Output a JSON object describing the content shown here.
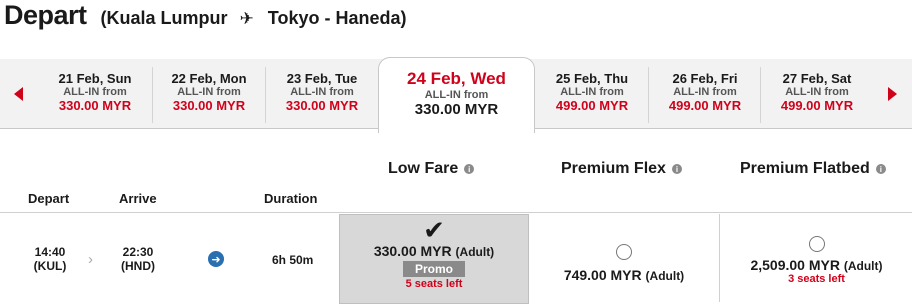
{
  "header": {
    "title": "Depart",
    "origin": "(Kuala Lumpur",
    "destination": "Tokyo - Haneda)",
    "plane_icon": "airplane-icon"
  },
  "dates": [
    {
      "label": "21 Feb, Sun",
      "sub": "ALL-IN from",
      "price": "330.00 MYR"
    },
    {
      "label": "22 Feb, Mon",
      "sub": "ALL-IN from",
      "price": "330.00 MYR"
    },
    {
      "label": "23 Feb, Tue",
      "sub": "ALL-IN from",
      "price": "330.00 MYR"
    },
    {
      "label": "24 Feb, Wed",
      "sub": "ALL-IN from",
      "price": "330.00 MYR"
    },
    {
      "label": "25 Feb, Thu",
      "sub": "ALL-IN from",
      "price": "499.00 MYR"
    },
    {
      "label": "26 Feb, Fri",
      "sub": "ALL-IN from",
      "price": "499.00 MYR"
    },
    {
      "label": "27 Feb, Sat",
      "sub": "ALL-IN from",
      "price": "499.00 MYR"
    }
  ],
  "fare_types": [
    {
      "label": "Low Fare"
    },
    {
      "label": "Premium Flex"
    },
    {
      "label": "Premium Flatbed"
    }
  ],
  "columns": {
    "depart": "Depart",
    "arrive": "Arrive",
    "duration": "Duration"
  },
  "flight": {
    "depart_time": "14:40",
    "depart_code": "(KUL)",
    "arrive_time": "22:30",
    "arrive_code": "(HND)",
    "duration": "6h 50m",
    "fares": [
      {
        "price": "330.00 MYR",
        "pax": "(Adult)",
        "badge": "Promo",
        "seats": "5 seats left",
        "selected": true
      },
      {
        "price": "749.00 MYR",
        "pax": "(Adult)",
        "seats": "",
        "selected": false
      },
      {
        "price": "2,509.00 MYR",
        "pax": "(Adult)",
        "seats": "3 seats left",
        "selected": false
      }
    ]
  },
  "colors": {
    "accent": "#d0021b",
    "selected_bg": "#d8d8d8",
    "bar_bg": "#f2f2f2"
  }
}
